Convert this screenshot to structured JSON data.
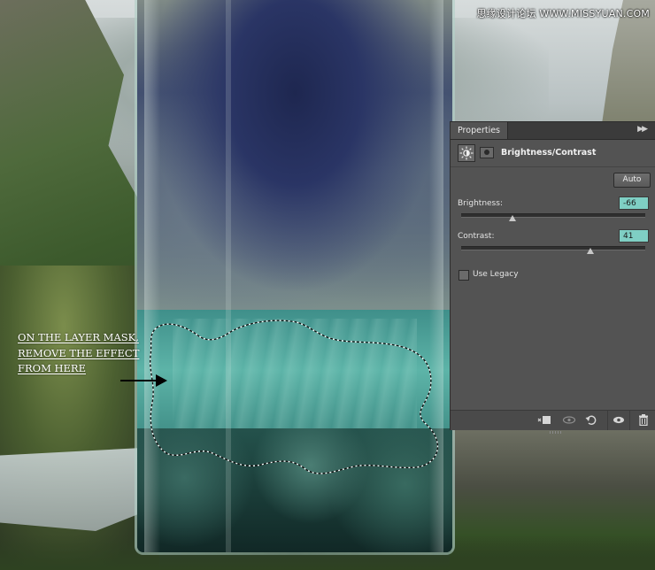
{
  "watermark": "思缘设计论坛 WWW.MISSYUAN.COM",
  "instructions": {
    "line1": "ON THE LAYER MASK,",
    "line2": "REMOVE THE EFFECT",
    "line3": "FROM HERE"
  },
  "properties_panel": {
    "tab_label": "Properties",
    "collapse_icon": "double-chevron-right-icon",
    "adjustment_icon": "brightness-contrast-icon",
    "mask_icon": "layer-mask-icon",
    "heading": "Brightness/Contrast",
    "auto_label": "Auto",
    "brightness": {
      "label": "Brightness:",
      "value": "-66",
      "slider_fraction": 0.28
    },
    "contrast": {
      "label": "Contrast:",
      "value": "41",
      "slider_fraction": 0.7
    },
    "use_legacy": {
      "label": "Use Legacy",
      "checked": false
    },
    "footer_icons": [
      "clip-to-layer-icon",
      "view-previous-state-icon",
      "reset-icon",
      "visibility-eye-icon",
      "delete-trash-icon"
    ]
  },
  "colors": {
    "panel_bg": "#535353",
    "value_highlight": "#7fcfc4",
    "text_light": "#e4e4e4"
  }
}
